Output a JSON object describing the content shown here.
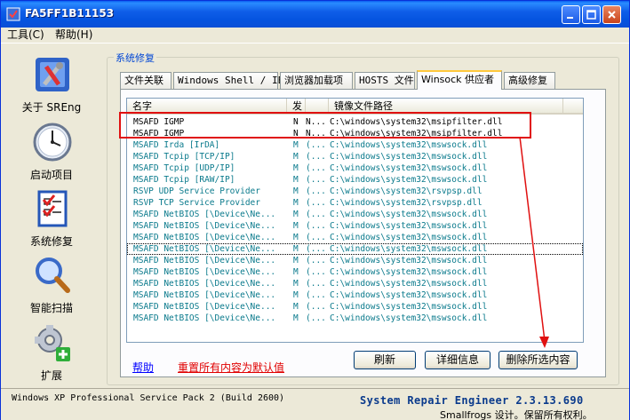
{
  "window": {
    "title": "FA5FF1B11153"
  },
  "menu": [
    {
      "label": "工具(C)"
    },
    {
      "label": "帮助(H)"
    }
  ],
  "nav": [
    {
      "label": "关于 SREng",
      "icon": "tools-icon"
    },
    {
      "label": "启动项目",
      "icon": "clock-icon"
    },
    {
      "label": "系统修复",
      "icon": "checklist-icon"
    },
    {
      "label": "智能扫描",
      "icon": "magnifier-icon"
    },
    {
      "label": "扩展",
      "icon": "puzzle-icon"
    }
  ],
  "group_title": "系统修复",
  "tabs": [
    {
      "label": "文件关联"
    },
    {
      "label": "Windows Shell / IE"
    },
    {
      "label": "浏览器加载项"
    },
    {
      "label": "HOSTS 文件"
    },
    {
      "label": "Winsock 供应者"
    },
    {
      "label": "高级修复"
    }
  ],
  "active_tab": "Winsock 供应者",
  "list": {
    "columns": [
      {
        "label": "名字"
      },
      {
        "label": "发"
      },
      {
        "label": ""
      },
      {
        "label": "镜像文件路径"
      }
    ],
    "rows": [
      {
        "name": "MSAFD IGMP",
        "c2": "N",
        "c3": "N...",
        "path": "C:\\windows\\system32\\msipfilter.dll",
        "color": "black"
      },
      {
        "name": "MSAFD IGMP",
        "c2": "N",
        "c3": "N...",
        "path": "C:\\windows\\system32\\msipfilter.dll",
        "color": "black"
      },
      {
        "name": "MSAFD Irda [IrDA]",
        "c2": "M",
        "c3": "(...",
        "path": "C:\\windows\\system32\\mswsock.dll",
        "color": "teal"
      },
      {
        "name": "MSAFD Tcpip [TCP/IP]",
        "c2": "M",
        "c3": "(...",
        "path": "C:\\windows\\system32\\mswsock.dll",
        "color": "teal"
      },
      {
        "name": "MSAFD Tcpip [UDP/IP]",
        "c2": "M",
        "c3": "(...",
        "path": "C:\\windows\\system32\\mswsock.dll",
        "color": "teal"
      },
      {
        "name": "MSAFD Tcpip [RAW/IP]",
        "c2": "M",
        "c3": "(...",
        "path": "C:\\windows\\system32\\mswsock.dll",
        "color": "teal"
      },
      {
        "name": "RSVP UDP Service Provider",
        "c2": "M",
        "c3": "(...",
        "path": "C:\\windows\\system32\\rsvpsp.dll",
        "color": "teal"
      },
      {
        "name": "RSVP TCP Service Provider",
        "c2": "M",
        "c3": "(...",
        "path": "C:\\windows\\system32\\rsvpsp.dll",
        "color": "teal"
      },
      {
        "name": "MSAFD NetBIOS [\\Device\\Ne...",
        "c2": "M",
        "c3": "(...",
        "path": "C:\\windows\\system32\\mswsock.dll",
        "color": "teal"
      },
      {
        "name": "MSAFD NetBIOS [\\Device\\Ne...",
        "c2": "M",
        "c3": "(...",
        "path": "C:\\windows\\system32\\mswsock.dll",
        "color": "teal"
      },
      {
        "name": "MSAFD NetBIOS [\\Device\\Ne...",
        "c2": "M",
        "c3": "(...",
        "path": "C:\\windows\\system32\\mswsock.dll",
        "color": "teal"
      },
      {
        "name": "MSAFD NetBIOS [\\Device\\Ne...",
        "c2": "M",
        "c3": "(...",
        "path": "C:\\windows\\system32\\mswsock.dll",
        "color": "teal",
        "focus": true
      },
      {
        "name": "MSAFD NetBIOS [\\Device\\Ne...",
        "c2": "M",
        "c3": "(...",
        "path": "C:\\windows\\system32\\mswsock.dll",
        "color": "teal"
      },
      {
        "name": "MSAFD NetBIOS [\\Device\\Ne...",
        "c2": "M",
        "c3": "(...",
        "path": "C:\\windows\\system32\\mswsock.dll",
        "color": "teal"
      },
      {
        "name": "MSAFD NetBIOS [\\Device\\Ne...",
        "c2": "M",
        "c3": "(...",
        "path": "C:\\windows\\system32\\mswsock.dll",
        "color": "teal"
      },
      {
        "name": "MSAFD NetBIOS [\\Device\\Ne...",
        "c2": "M",
        "c3": "(...",
        "path": "C:\\windows\\system32\\mswsock.dll",
        "color": "teal"
      },
      {
        "name": "MSAFD NetBIOS [\\Device\\Ne...",
        "c2": "M",
        "c3": "(...",
        "path": "C:\\windows\\system32\\mswsock.dll",
        "color": "teal"
      },
      {
        "name": "MSAFD NetBIOS [\\Device\\Ne...",
        "c2": "M",
        "c3": "(...",
        "path": "C:\\windows\\system32\\mswsock.dll",
        "color": "teal"
      }
    ]
  },
  "links": {
    "help": "帮助",
    "reset": "重置所有内容为默认值"
  },
  "buttons": {
    "refresh": "刷新",
    "detail": "详细信息",
    "delete": "删除所选内容"
  },
  "status": {
    "os": "Windows XP Professional Service Pack 2 (Build 2600)",
    "product": "System Repair Engineer 2.3.13.690",
    "copyright": "Smallfrogs 设计。保留所有权利。"
  },
  "colors": {
    "teal_row": "#0a7a8c",
    "highlight": "#e01010",
    "link": "#0000ff",
    "reset_link": "#e00000"
  }
}
